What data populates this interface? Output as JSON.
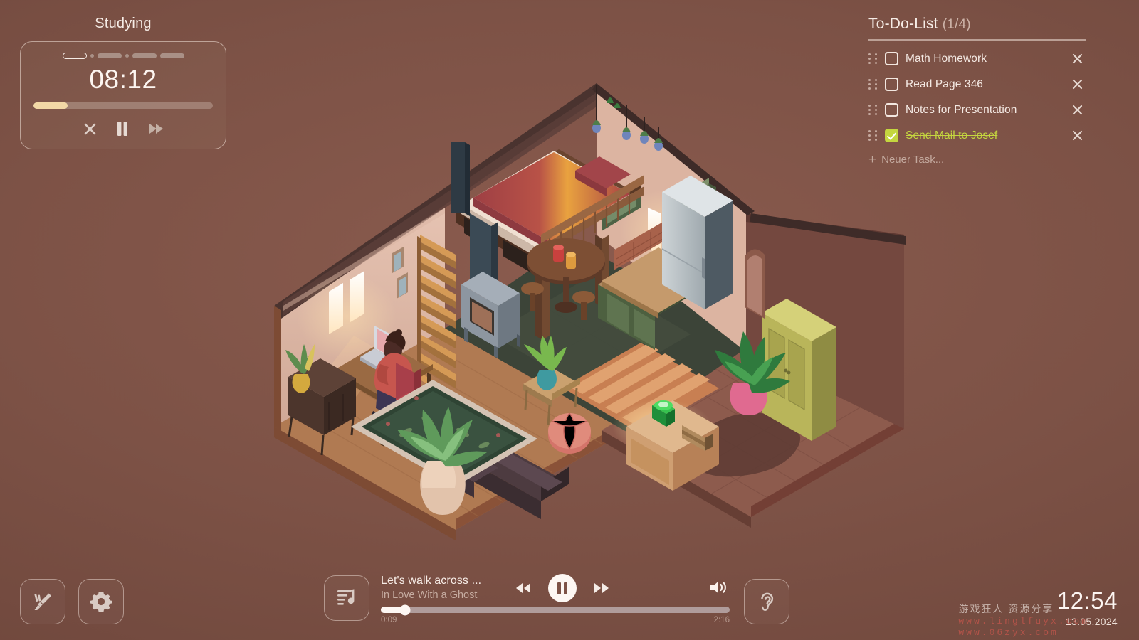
{
  "app": {
    "background_color": "#7d5246",
    "accent_cream": "#f2d8a6",
    "accent_green": "#c4d63f"
  },
  "timer": {
    "activity_label": "Studying",
    "time_remaining": "08:12",
    "progress_percent": 19,
    "sessions": [
      {
        "type": "bar",
        "state": "active"
      },
      {
        "type": "dot",
        "state": "done"
      },
      {
        "type": "bar",
        "state": "done"
      },
      {
        "type": "dot",
        "state": "done"
      },
      {
        "type": "bar",
        "state": "done"
      },
      {
        "type": "bar",
        "state": "done"
      }
    ],
    "controls": [
      {
        "name": "stop-timer-button",
        "icon": "close-icon",
        "label": "Stop"
      },
      {
        "name": "pause-timer-button",
        "icon": "pause-icon",
        "label": "Pause"
      },
      {
        "name": "skip-timer-button",
        "icon": "skip-forward-icon",
        "label": "Skip"
      }
    ]
  },
  "todo": {
    "title": "To-Do-List",
    "count": "(1/4)",
    "items": [
      {
        "label": "Math Homework",
        "done": false
      },
      {
        "label": "Read Page 346",
        "done": false
      },
      {
        "label": "Notes for Presentation",
        "done": false
      },
      {
        "label": "Send Mail to Josef",
        "done": true
      }
    ],
    "add_plus": "+",
    "add_label": "Neuer Task..."
  },
  "tools": [
    {
      "name": "decorate-button",
      "icon": "paintbrush-icon",
      "label": "Decorate"
    },
    {
      "name": "settings-button",
      "icon": "gear-icon",
      "label": "Settings"
    }
  ],
  "music": {
    "album_icon": "playlist-music-icon",
    "title": "Let's walk across ...",
    "artist": "In Love With a Ghost",
    "elapsed": "0:09",
    "duration": "2:16",
    "progress_percent": 7,
    "controls": [
      {
        "name": "previous-track-button",
        "icon": "rewind-icon"
      },
      {
        "name": "play-pause-button",
        "icon": "pause-icon"
      },
      {
        "name": "next-track-button",
        "icon": "fast-forward-icon"
      }
    ],
    "volume_icon": "volume-high-icon"
  },
  "ambient": {
    "name": "ambient-sounds-button",
    "icon": "ear-icon",
    "label": "Ambient Sounds"
  },
  "clock": {
    "time": "12:54",
    "date": "13.05.2024"
  },
  "watermark": {
    "cn_text": "游戏狂人 资源分享",
    "line1": "www.linglfuyx.com",
    "line2": "www.06zyx.com"
  }
}
